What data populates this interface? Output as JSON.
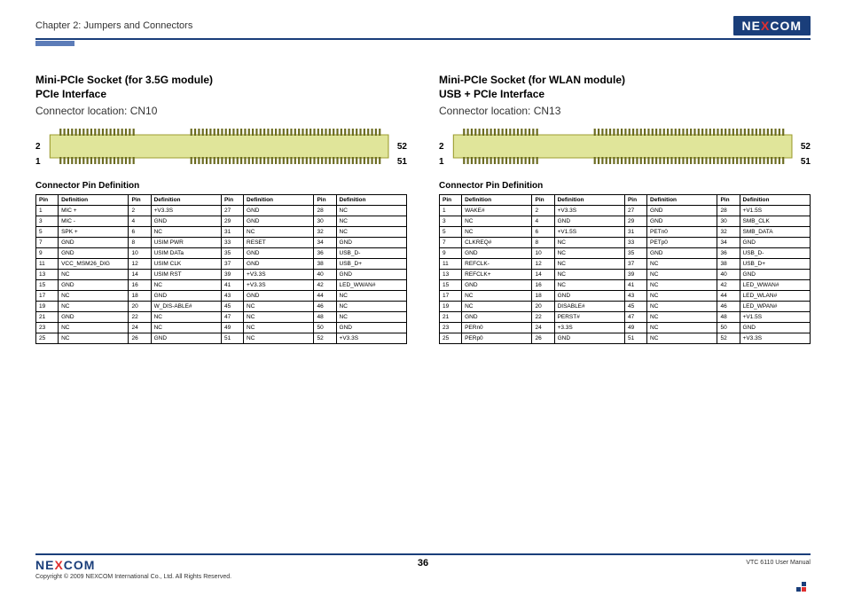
{
  "header": {
    "chapter": "Chapter 2: Jumpers and Connectors",
    "brand_pre": "NE",
    "brand_x": "X",
    "brand_post": "COM"
  },
  "left": {
    "title_line1": "Mini-PCIe Socket (for 3.5G module)",
    "title_line2": "PCIe Interface",
    "connector_location": "Connector location: CN10",
    "pin_top_left": "2",
    "pin_top_right": "52",
    "pin_bot_left": "1",
    "pin_bot_right": "51",
    "cpd_title": "Connector Pin Definition",
    "headers": [
      "Pin",
      "Definition",
      "Pin",
      "Definition",
      "Pin",
      "Definition",
      "Pin",
      "Definition"
    ],
    "rows": [
      [
        "1",
        "MIC +",
        "2",
        "+V3.3S",
        "27",
        "GND",
        "28",
        "NC"
      ],
      [
        "3",
        "MIC -",
        "4",
        "GND",
        "29",
        "GND",
        "30",
        "NC"
      ],
      [
        "5",
        "SPK +",
        "6",
        "NC",
        "31",
        "NC",
        "32",
        "NC"
      ],
      [
        "7",
        "GND",
        "8",
        "USIM PWR",
        "33",
        "RESET",
        "34",
        "GND"
      ],
      [
        "9",
        "GND",
        "10",
        "USIM DATa",
        "35",
        "GND",
        "36",
        "USB_D-"
      ],
      [
        "11",
        "VCC_MSM26_DIG",
        "12",
        "USIM CLK",
        "37",
        "GND",
        "38",
        "USB_D+"
      ],
      [
        "13",
        "NC",
        "14",
        "USIM RST",
        "39",
        "+V3.3S",
        "40",
        "GND"
      ],
      [
        "15",
        "GND",
        "16",
        "NC",
        "41",
        "+V3.3S",
        "42",
        "LED_WWAN#"
      ],
      [
        "17",
        "NC",
        "18",
        "GND",
        "43",
        "GND",
        "44",
        "NC"
      ],
      [
        "19",
        "NC",
        "20",
        "W_DIS-ABLE#",
        "45",
        "NC",
        "46",
        "NC"
      ],
      [
        "21",
        "GND",
        "22",
        "NC",
        "47",
        "NC",
        "48",
        "NC"
      ],
      [
        "23",
        "NC",
        "24",
        "NC",
        "49",
        "NC",
        "50",
        "GND"
      ],
      [
        "25",
        "NC",
        "26",
        "GND",
        "51",
        "NC",
        "52",
        "+V3.3S"
      ]
    ]
  },
  "right": {
    "title_line1": "Mini-PCIe Socket (for WLAN module)",
    "title_line2": "USB + PCIe Interface",
    "connector_location": "Connector location: CN13",
    "pin_top_left": "2",
    "pin_top_right": "52",
    "pin_bot_left": "1",
    "pin_bot_right": "51",
    "cpd_title": "Connector Pin Definition",
    "headers": [
      "Pin",
      "Definition",
      "Pin",
      "Definition",
      "Pin",
      "Definition",
      "Pin",
      "Definition"
    ],
    "rows": [
      [
        "1",
        "WAKE#",
        "2",
        "+V3.3S",
        "27",
        "GND",
        "28",
        "+V1.5S"
      ],
      [
        "3",
        "NC",
        "4",
        "GND",
        "29",
        "GND",
        "30",
        "SMB_CLK"
      ],
      [
        "5",
        "NC",
        "6",
        "+V1.5S",
        "31",
        "PETn0",
        "32",
        "SMB_DATA"
      ],
      [
        "7",
        "CLKREQ#",
        "8",
        "NC",
        "33",
        "PETp0",
        "34",
        "GND"
      ],
      [
        "9",
        "GND",
        "10",
        "NC",
        "35",
        "GND",
        "36",
        "USB_D-"
      ],
      [
        "11",
        "REFCLK-",
        "12",
        "NC",
        "37",
        "NC",
        "38",
        "USB_D+"
      ],
      [
        "13",
        "REFCLK+",
        "14",
        "NC",
        "39",
        "NC",
        "40",
        "GND"
      ],
      [
        "15",
        "GND",
        "16",
        "NC",
        "41",
        "NC",
        "42",
        "LED_WWAN#"
      ],
      [
        "17",
        "NC",
        "18",
        "GND",
        "43",
        "NC",
        "44",
        "LED_WLAN#"
      ],
      [
        "19",
        "NC",
        "20",
        "DISABLE#",
        "45",
        "NC",
        "46",
        "LED_WPAN#"
      ],
      [
        "21",
        "GND",
        "22",
        "PERST#",
        "47",
        "NC",
        "48",
        "+V1.5S"
      ],
      [
        "23",
        "PERn0",
        "24",
        "+3.3S",
        "49",
        "NC",
        "50",
        "GND"
      ],
      [
        "25",
        "PERp0",
        "26",
        "GND",
        "51",
        "NC",
        "52",
        "+V3.3S"
      ]
    ]
  },
  "footer": {
    "copyright": "Copyright © 2009 NEXCOM International Co., Ltd. All Rights Reserved.",
    "page": "36",
    "manual": "VTC 6110 User Manual"
  }
}
